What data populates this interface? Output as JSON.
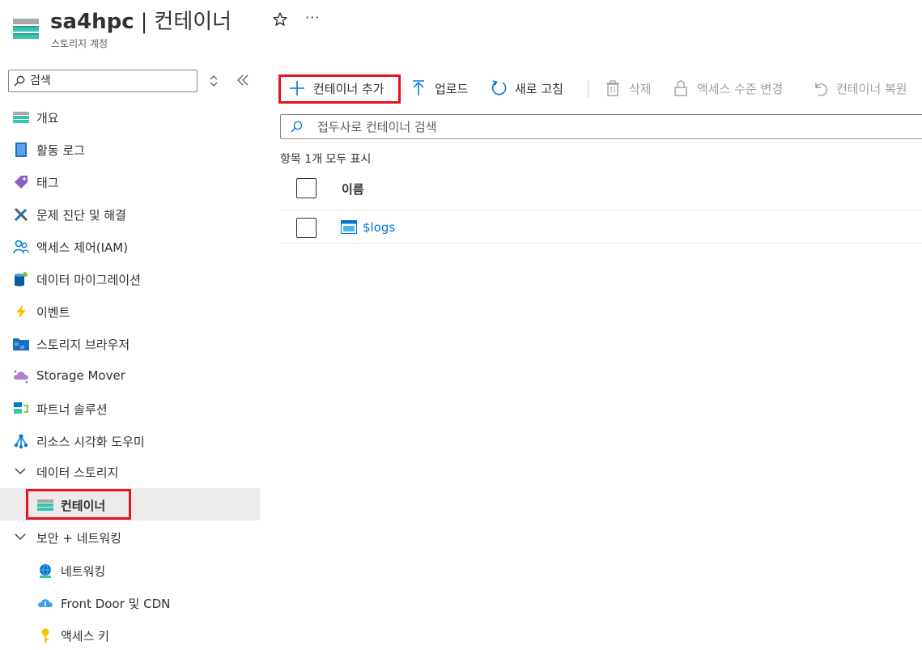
{
  "header": {
    "title": "sa4hpc",
    "separator": "|",
    "page": "컨테이너",
    "subtitle": "스토리지 계정",
    "more": "···"
  },
  "sidebar": {
    "search_placeholder": "검색",
    "items": [
      {
        "label": "개요",
        "icon": "overview-icon"
      },
      {
        "label": "활동 로그",
        "icon": "activity-log-icon"
      },
      {
        "label": "태그",
        "icon": "tag-icon"
      },
      {
        "label": "문제 진단 및 해결",
        "icon": "diagnose-icon"
      },
      {
        "label": "액세스 제어(IAM)",
        "icon": "iam-icon"
      },
      {
        "label": "데이터 마이그레이션",
        "icon": "data-migration-icon"
      },
      {
        "label": "이벤트",
        "icon": "events-icon"
      },
      {
        "label": "스토리지 브라우저",
        "icon": "storage-browser-icon"
      },
      {
        "label": "Storage Mover",
        "icon": "storage-mover-icon"
      },
      {
        "label": "파트너 솔루션",
        "icon": "partner-solutions-icon"
      },
      {
        "label": "리소스 시각화 도우미",
        "icon": "resource-visualizer-icon"
      }
    ],
    "groups": [
      {
        "label": "데이터 스토리지",
        "children": [
          {
            "label": "컨테이너",
            "selected": true
          }
        ]
      },
      {
        "label": "보안 + 네트워킹",
        "children": [
          {
            "label": "네트워킹"
          },
          {
            "label": "Front Door 및 CDN"
          },
          {
            "label": "액세스 키"
          }
        ]
      }
    ]
  },
  "toolbar": {
    "add_container": "컨테이너 추가",
    "upload": "업로드",
    "refresh": "새로 고침",
    "delete": "삭제",
    "change_access": "액세스 수준 변경",
    "restore": "컨테이너 복원"
  },
  "main": {
    "filter_placeholder": "접두사로 컨테이너 검색",
    "count_text": "항목 1개 모두 표시",
    "columns": [
      "이름"
    ],
    "rows": [
      {
        "name": "$logs"
      }
    ]
  },
  "colors": {
    "accent": "#0078d4",
    "highlight": "#e81123",
    "selected_bg": "#edebe9"
  }
}
